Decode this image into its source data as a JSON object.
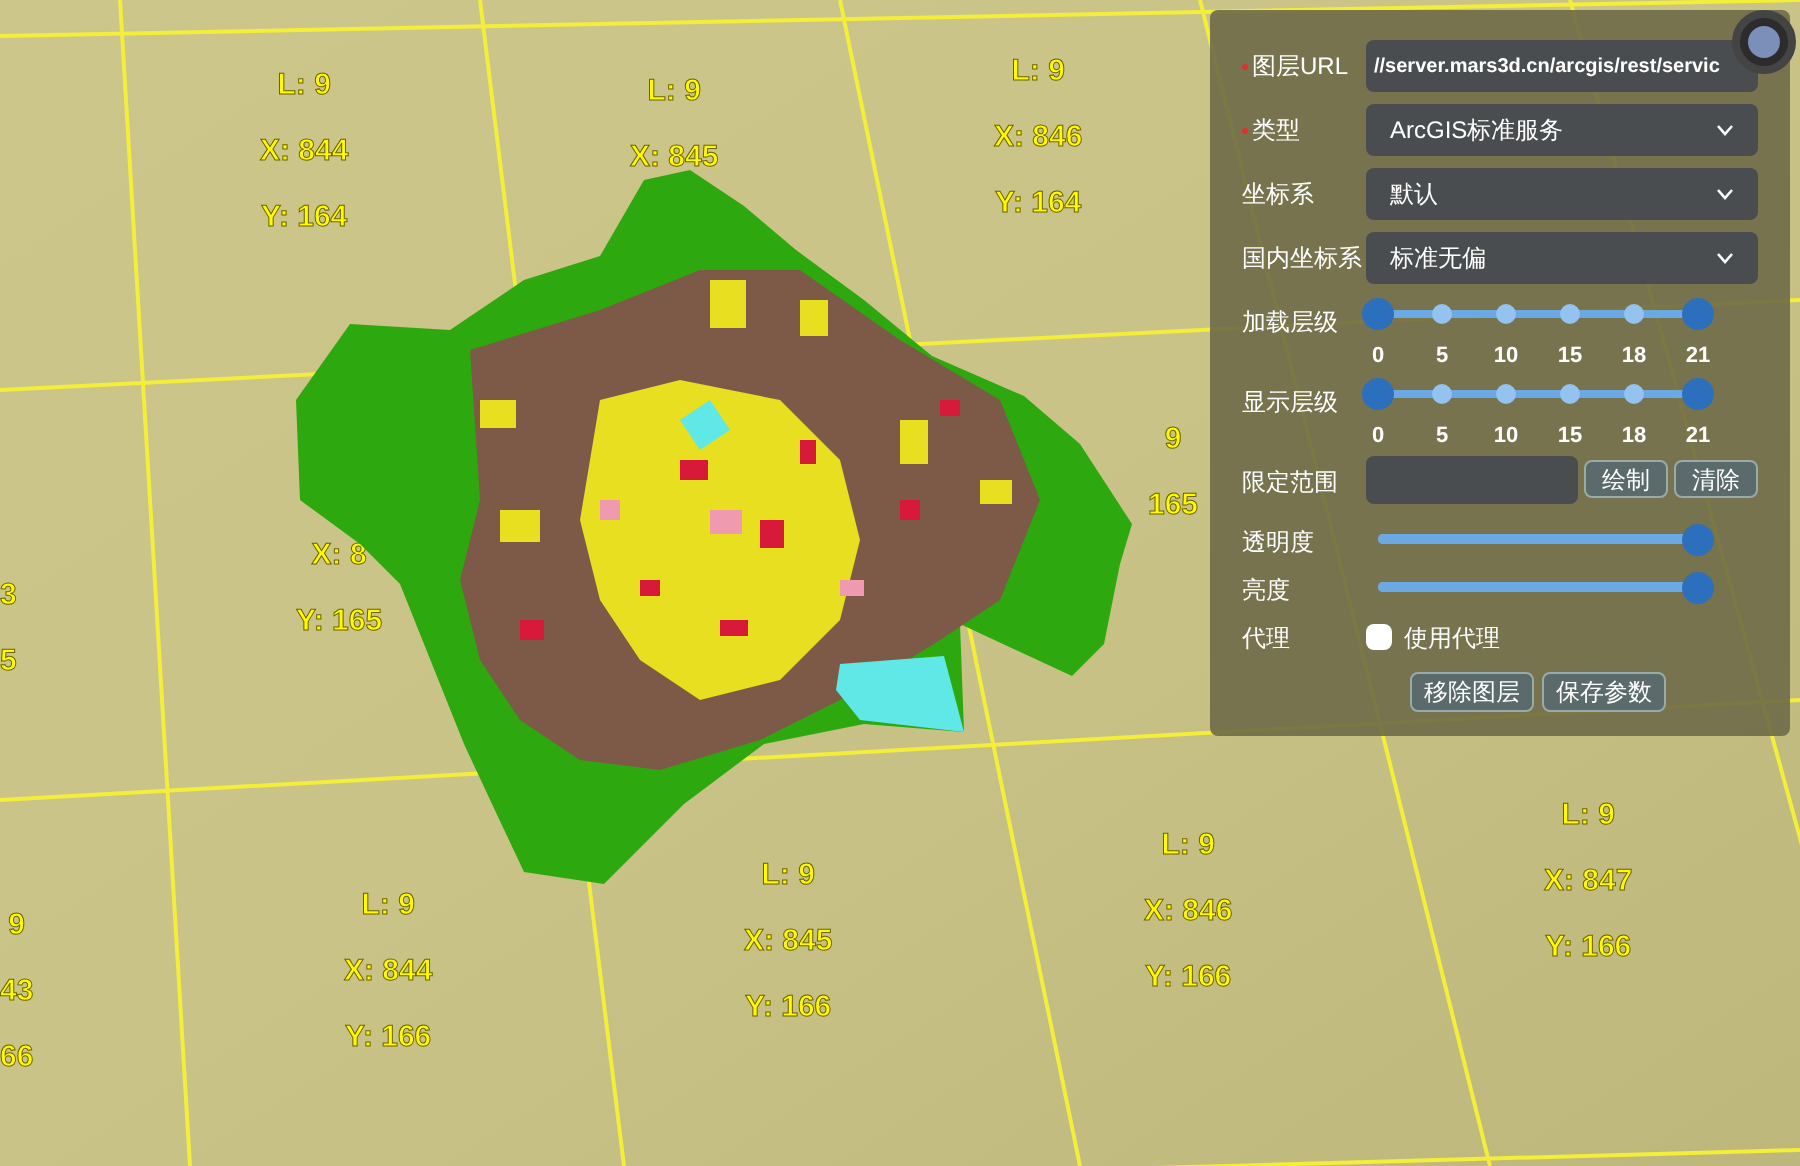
{
  "map": {
    "tile_labels": [
      {
        "lines": [
          "L: 9",
          "X: 844",
          "Y: 164"
        ]
      },
      {
        "lines": [
          "L: 9",
          "X: 845"
        ]
      },
      {
        "lines": [
          "L: 9",
          "X: 846",
          "Y: 164"
        ]
      },
      {
        "lines": [
          "X: 8",
          "Y: 165"
        ]
      },
      {
        "lines": [
          "9",
          "165"
        ]
      },
      {
        "lines": [
          "3",
          "5"
        ]
      },
      {
        "lines": [
          "9",
          "43",
          "66"
        ]
      },
      {
        "lines": [
          "L: 9",
          "X: 844",
          "Y: 166"
        ]
      },
      {
        "lines": [
          "L: 9",
          "X: 845",
          "Y: 166"
        ]
      },
      {
        "lines": [
          "L: 9",
          "X: 846",
          "Y: 166"
        ]
      },
      {
        "lines": [
          "L: 9",
          "X: 847",
          "Y: 166"
        ]
      }
    ]
  },
  "panel": {
    "rows": [
      {
        "kind": "input",
        "label": "图层URL",
        "required": true,
        "value": "//server.mars3d.cn/arcgis/rest/servic"
      },
      {
        "kind": "select",
        "label": "类型",
        "required": true,
        "value": "ArcGIS标准服务"
      },
      {
        "kind": "select",
        "label": "坐标系",
        "required": false,
        "value": "默认"
      },
      {
        "kind": "select",
        "label": "国内坐标系",
        "required": false,
        "value": "标准无偏"
      },
      {
        "kind": "range",
        "label": "加载层级",
        "required": false,
        "marks": [
          "0",
          "5",
          "10",
          "15",
          "18",
          "21"
        ],
        "thumbs": [
          {
            "level": 0
          },
          {
            "level": 1
          }
        ]
      },
      {
        "kind": "range",
        "label": "显示层级",
        "required": false,
        "marks": [
          "0",
          "5",
          "10",
          "15",
          "18",
          "21"
        ],
        "thumbs": [
          {
            "level": 0
          },
          {
            "level": 1
          }
        ]
      },
      {
        "kind": "extent",
        "label": "限定范围",
        "required": false,
        "buttons": [
          "绘制",
          "清除"
        ]
      },
      {
        "kind": "slider",
        "label": "透明度",
        "required": false,
        "level": 1
      },
      {
        "kind": "slider",
        "label": "亮度",
        "required": false,
        "level": 1
      },
      {
        "kind": "checkbox",
        "label": "代理",
        "required": false,
        "checked": false,
        "text": "使用代理"
      }
    ],
    "buttons": [
      "移除图层",
      "保存参数"
    ]
  }
}
